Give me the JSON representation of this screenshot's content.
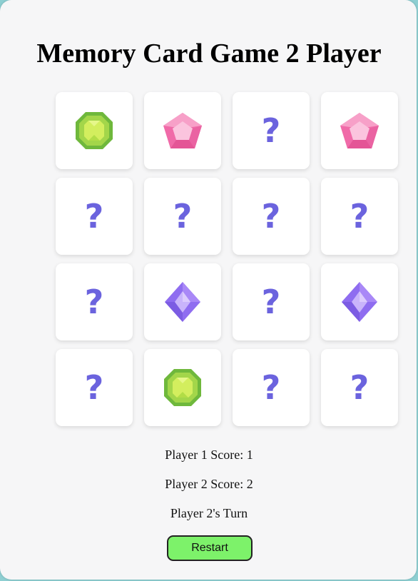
{
  "game": {
    "title": "Memory Card Game 2 Player",
    "hidden_symbol": "?",
    "cards": [
      {
        "state": "revealed",
        "icon": "green-gem"
      },
      {
        "state": "revealed",
        "icon": "pink-gem"
      },
      {
        "state": "hidden"
      },
      {
        "state": "revealed",
        "icon": "pink-gem"
      },
      {
        "state": "hidden"
      },
      {
        "state": "hidden"
      },
      {
        "state": "hidden"
      },
      {
        "state": "hidden"
      },
      {
        "state": "hidden"
      },
      {
        "state": "revealed",
        "icon": "purple-gem"
      },
      {
        "state": "hidden"
      },
      {
        "state": "revealed",
        "icon": "purple-gem"
      },
      {
        "state": "hidden"
      },
      {
        "state": "revealed",
        "icon": "green-gem"
      },
      {
        "state": "hidden"
      },
      {
        "state": "hidden"
      }
    ],
    "scores": {
      "player1": "Player 1 Score: 1",
      "player2": "Player 2 Score: 2"
    },
    "turn": "Player 2's Turn",
    "restart_label": "Restart"
  },
  "colors": {
    "accent_question": "#6b63de",
    "restart_button": "#7df26a",
    "panel_background": "#f6f6f7"
  }
}
